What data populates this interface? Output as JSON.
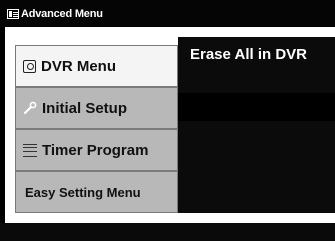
{
  "title_bar": {
    "title": "Advanced Menu",
    "icon": "menu-icon"
  },
  "menu": {
    "items": [
      {
        "label": "DVR Menu",
        "icon": "dvr-icon",
        "selected": true
      },
      {
        "label": "Initial Setup",
        "icon": "wrench-icon",
        "selected": false
      },
      {
        "label": "Timer Program",
        "icon": "timer-program-icon",
        "selected": false
      },
      {
        "label": "Easy Setting Menu",
        "icon": "",
        "selected": false
      }
    ]
  },
  "submenu": {
    "items": [
      "Erase All in DVR"
    ]
  },
  "colors": {
    "background": "#000000",
    "panel": "#ffffff",
    "selected_item": "#f4f4f4",
    "unselected_item": "#b8b8b8",
    "submenu_bg": "#0b0b0b",
    "submenu_row_dark": "#000000",
    "text_light": "#ffffff",
    "text_dark": "#111111"
  }
}
